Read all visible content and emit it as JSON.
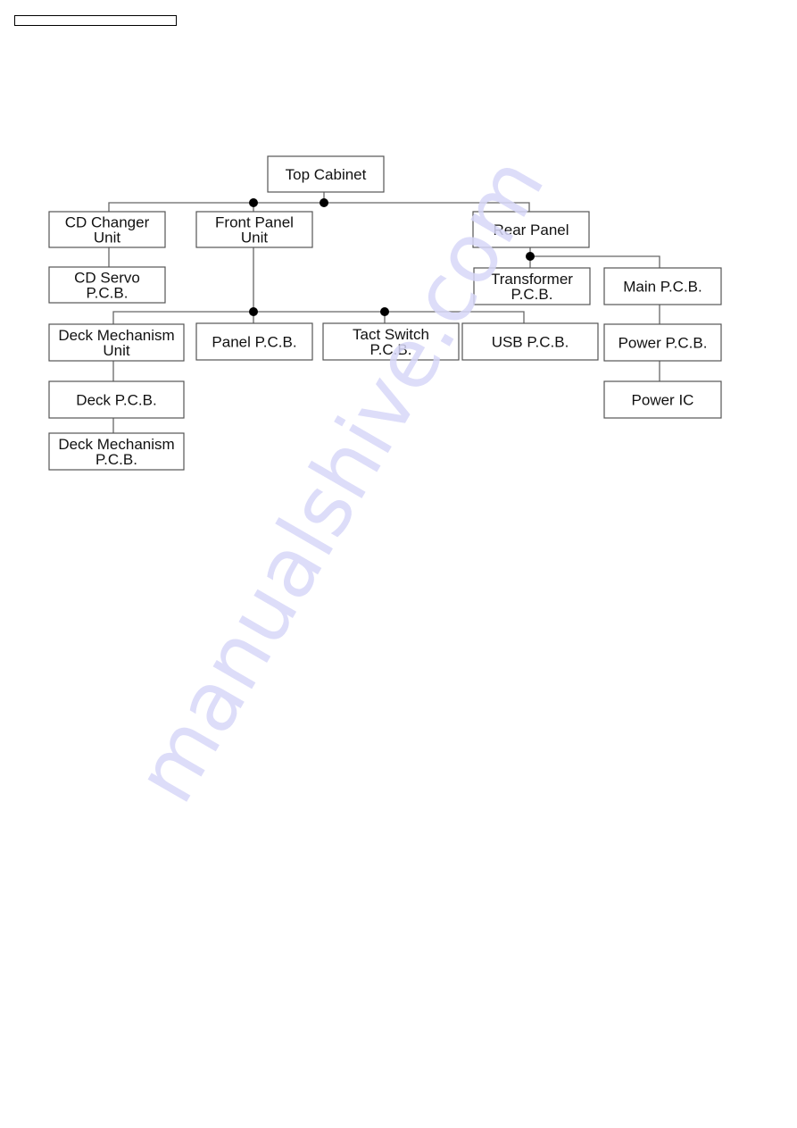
{
  "page": {
    "header_box_text": "",
    "watermark": "manualshive.com"
  },
  "diagram": {
    "title": "",
    "nodes": [
      {
        "id": "top_cabinet",
        "lines": [
          "Top Cabinet"
        ]
      },
      {
        "id": "cd_changer_unit",
        "lines": [
          "CD Changer",
          "Unit"
        ]
      },
      {
        "id": "front_panel_unit",
        "lines": [
          "Front Panel",
          "Unit"
        ]
      },
      {
        "id": "rear_panel",
        "lines": [
          "Rear Panel"
        ]
      },
      {
        "id": "cd_servo_pcb",
        "lines": [
          "CD Servo",
          "P.C.B."
        ]
      },
      {
        "id": "transformer_pcb",
        "lines": [
          "Transformer",
          "P.C.B."
        ]
      },
      {
        "id": "main_pcb",
        "lines": [
          "Main P.C.B."
        ]
      },
      {
        "id": "deck_mechanism_unit",
        "lines": [
          "Deck Mechanism",
          "Unit"
        ]
      },
      {
        "id": "panel_pcb",
        "lines": [
          "Panel P.C.B."
        ]
      },
      {
        "id": "tact_switch_pcb",
        "lines": [
          "Tact Switch",
          "P.C.B."
        ]
      },
      {
        "id": "usb_pcb",
        "lines": [
          "USB P.C.B."
        ]
      },
      {
        "id": "power_pcb",
        "lines": [
          "Power P.C.B."
        ]
      },
      {
        "id": "deck_pcb",
        "lines": [
          "Deck P.C.B."
        ]
      },
      {
        "id": "power_ic",
        "lines": [
          "Power IC"
        ]
      },
      {
        "id": "deck_mechanism_pcb",
        "lines": [
          "Deck Mechanism",
          "P.C.B."
        ]
      }
    ],
    "edges": [
      [
        "top_cabinet",
        "cd_changer_unit"
      ],
      [
        "top_cabinet",
        "front_panel_unit"
      ],
      [
        "top_cabinet",
        "rear_panel"
      ],
      [
        "cd_changer_unit",
        "cd_servo_pcb"
      ],
      [
        "front_panel_unit",
        "deck_mechanism_unit"
      ],
      [
        "front_panel_unit",
        "panel_pcb"
      ],
      [
        "front_panel_unit",
        "tact_switch_pcb"
      ],
      [
        "front_panel_unit",
        "usb_pcb"
      ],
      [
        "rear_panel",
        "transformer_pcb"
      ],
      [
        "rear_panel",
        "main_pcb"
      ],
      [
        "main_pcb",
        "power_pcb"
      ],
      [
        "power_pcb",
        "power_ic"
      ],
      [
        "deck_mechanism_unit",
        "deck_pcb"
      ],
      [
        "deck_pcb",
        "deck_mechanism_pcb"
      ]
    ]
  }
}
